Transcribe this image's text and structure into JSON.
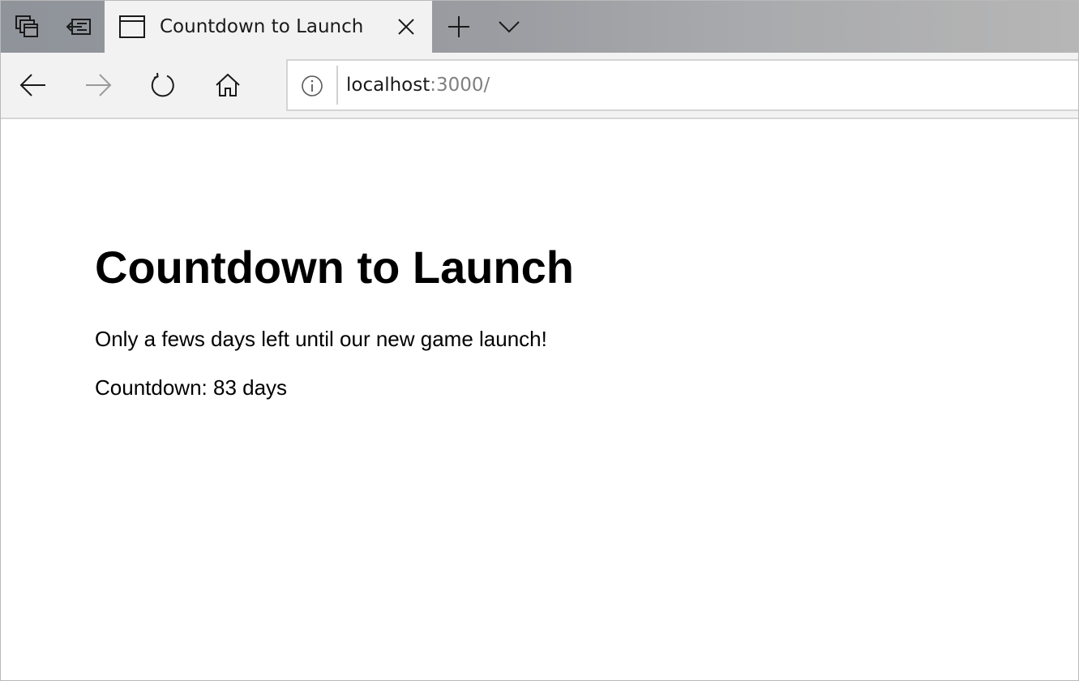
{
  "browser": {
    "tab": {
      "title": "Countdown to Launch"
    },
    "address_bar": {
      "host": "localhost",
      "path": ":3000/"
    },
    "icons": {
      "tab_manager": "tab-manager-icon",
      "set_aside": "set-aside-tabs-icon",
      "favicon": "window-icon",
      "close": "close-icon",
      "new_tab": "plus-icon",
      "tab_list": "chevron-down-icon",
      "back": "back-arrow-icon",
      "forward": "forward-arrow-icon",
      "refresh": "refresh-icon",
      "home": "home-icon",
      "site_info": "info-icon"
    }
  },
  "page": {
    "heading": "Countdown to Launch",
    "intro": "Only a fews days left until our new game launch!",
    "countdown": "Countdown: 83 days"
  }
}
